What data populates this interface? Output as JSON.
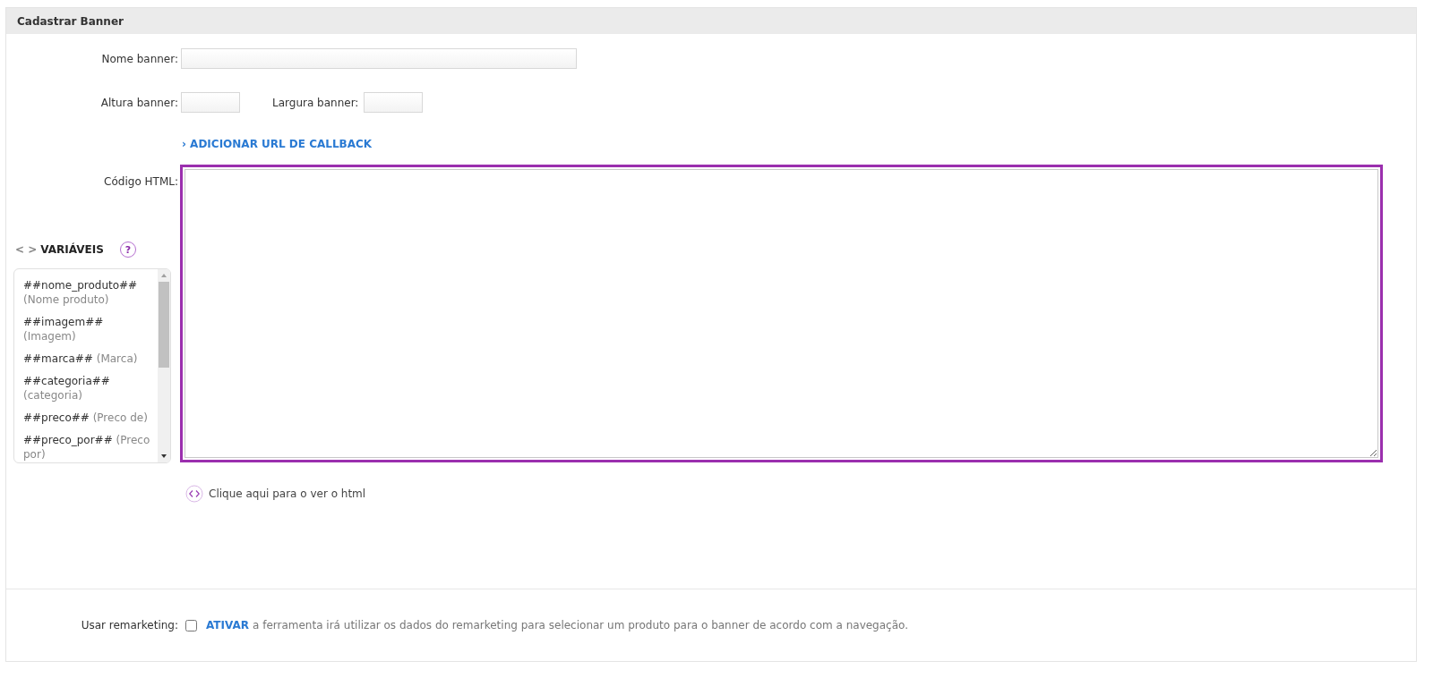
{
  "panel": {
    "title": "Cadastrar Banner"
  },
  "name_field": {
    "label": "Nome banner:"
  },
  "height_field": {
    "label": "Altura banner:"
  },
  "width_field": {
    "label": "Largura banner:"
  },
  "callback_link": "› ADICIONAR URL DE CALLBACK",
  "html_code": {
    "label": "Código HTML:",
    "focused": true
  },
  "variables": {
    "prefix": "< >",
    "title": "VARIÁVEIS",
    "help": "?",
    "items": [
      {
        "token": "##nome_produto##",
        "description": "(Nome produto)"
      },
      {
        "token": "##imagem##",
        "description": "(Imagem)"
      },
      {
        "token": "##marca##",
        "description": "(Marca)"
      },
      {
        "token": "##categoria##",
        "description": "(categoria)"
      },
      {
        "token": "##preco##",
        "description": "(Preco de)"
      },
      {
        "token": "##preco_por##",
        "description": "(Preco por)"
      }
    ]
  },
  "view_html_link": "Clique aqui para o ver o html",
  "remarketing": {
    "label": "Usar remarketing:",
    "checked": false,
    "action": "ATIVAR",
    "description": "a ferramenta irá utilizar os dados do remarketing para selecionar um produto para o banner de acordo com a navegação."
  }
}
